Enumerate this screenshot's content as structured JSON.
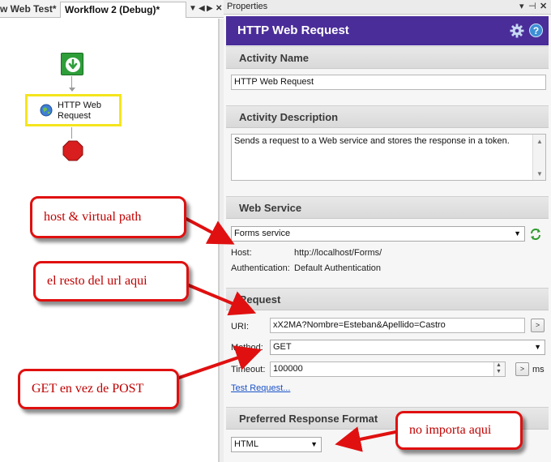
{
  "designer": {
    "tabs": [
      {
        "label": "w Web Test*"
      },
      {
        "label": "Workflow 2 (Debug)*"
      }
    ],
    "activity_label": "HTTP Web Request"
  },
  "properties": {
    "panel_title": "Properties",
    "header_title": "HTTP Web Request",
    "activity_name": {
      "heading": "Activity Name",
      "value": "HTTP Web Request"
    },
    "activity_description": {
      "heading": "Activity Description",
      "value": "Sends a request to a Web service and stores the response in a token."
    },
    "web_service": {
      "heading": "Web Service",
      "selected": "Forms service",
      "host_label": "Host:",
      "host_value": "http://localhost/Forms/",
      "auth_label": "Authentication:",
      "auth_value": "Default Authentication"
    },
    "request": {
      "heading": "Request",
      "uri_label": "URI:",
      "uri_value": "xX2MA?Nombre=Esteban&Apellido=Castro",
      "method_label": "Method:",
      "method_value": "GET",
      "timeout_label": "Timeout:",
      "timeout_value": "100000",
      "timeout_unit": "ms",
      "test_link": "Test Request..."
    },
    "response_format": {
      "heading": "Preferred Response Format",
      "selected": "HTML"
    }
  },
  "callouts": {
    "host": "host & virtual path",
    "url": "el resto del url aqui",
    "method": "GET en vez de POST",
    "format": "no importa aqui"
  },
  "colors": {
    "header_purple": "#4a2d99",
    "callout_red": "#e01010",
    "start_green": "#2e9e3a",
    "highlight_yellow": "#f5e51c",
    "link_blue": "#1b52c8"
  }
}
